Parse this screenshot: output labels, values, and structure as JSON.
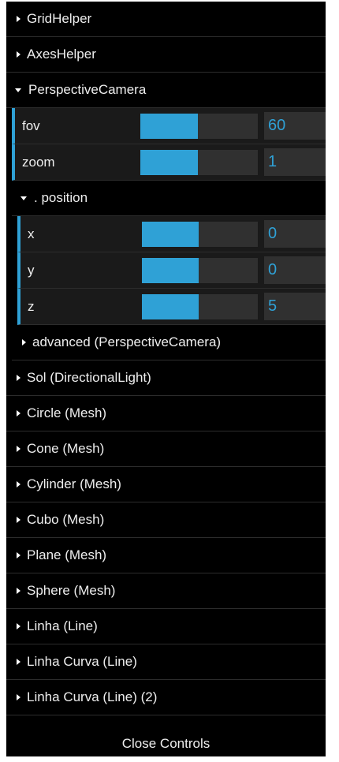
{
  "gui": {
    "folders_top": [
      "GridHelper",
      "AxesHelper"
    ],
    "camera": {
      "label": "PerspectiveCamera",
      "controls": [
        {
          "label": "fov",
          "value": "60",
          "fill": 0.49
        },
        {
          "label": "zoom",
          "value": "1",
          "fill": 0.49
        }
      ],
      "position": {
        "label": ". position",
        "controls": [
          {
            "label": "x",
            "value": "0",
            "fill": 0.49
          },
          {
            "label": "y",
            "value": "0",
            "fill": 0.49
          },
          {
            "label": "z",
            "value": "5",
            "fill": 0.49
          }
        ]
      },
      "advanced_label": "advanced (PerspectiveCamera)"
    },
    "folders_bottom": [
      "Sol (DirectionalLight)",
      "Circle (Mesh)",
      "Cone (Mesh)",
      "Cylinder (Mesh)",
      "Cubo (Mesh)",
      "Plane (Mesh)",
      "Sphere (Mesh)",
      "Linha (Line)",
      "Linha Curva (Line)",
      "Linha Curva (Line) (2)"
    ],
    "close_label": "Close Controls",
    "colors": {
      "accent": "#2fa1d6",
      "panel_bg": "#000000",
      "row_bg": "#1a1a1a",
      "input_bg": "#303030"
    }
  }
}
